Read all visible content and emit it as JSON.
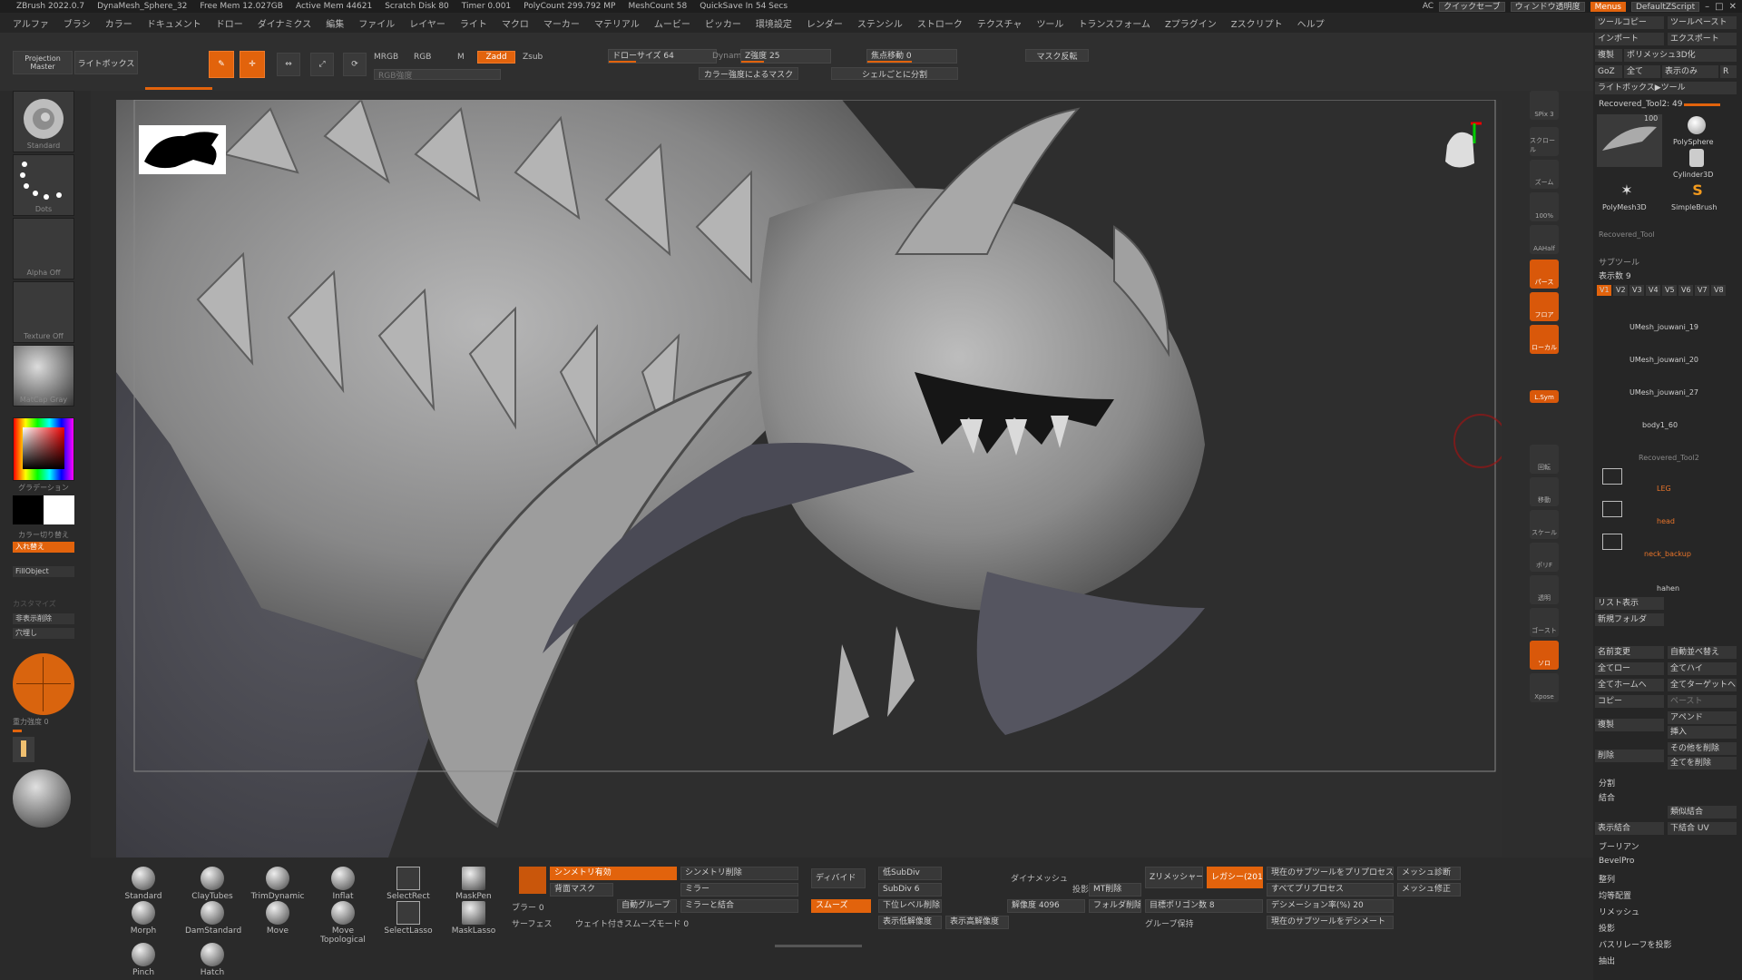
{
  "titlebar": {
    "items": [
      "ZBrush 2022.0.7",
      "DynaMesh_Sphere_32",
      "Free Mem 12.027GB",
      "Active Mem 44621",
      "Scratch Disk 80",
      "Timer 0.001",
      "PolyCount 299.792 MP",
      "MeshCount 58",
      "QuickSave In 54 Secs"
    ],
    "ac": "AC",
    "quicksave": "クイックセーブ",
    "window_transparency": "ウィンドウ透明度",
    "menu": "Menus",
    "default_zscript": "DefaultZScript"
  },
  "menubar": [
    "アルファ",
    "ブラシ",
    "カラー",
    "ドキュメント",
    "ドロー",
    "ダイナミクス",
    "編集",
    "ファイル",
    "レイヤー",
    "ライト",
    "マクロ",
    "マーカー",
    "マテリアル",
    "ムービー",
    "ピッカー",
    "環境設定",
    "レンダー",
    "ステンシル",
    "ストローク",
    "テクスチャ",
    "ツール",
    "トランスフォーム",
    "Zプラグイン",
    "Zスクリプト",
    "ヘルプ"
  ],
  "toolbar": {
    "projection_master": "Projection Master",
    "lightbox": "ライトボックス",
    "edit": "Edit",
    "draw": "Draw",
    "move": "移動",
    "scale": "スケール",
    "rotate": "回転",
    "mrgb": "MRGB",
    "rgb": "RGB",
    "m": "M",
    "zadd": "Zadd",
    "zsub": "Zsub",
    "draw_size": "ドローサイズ 64",
    "z_intensity": "Z強度 25",
    "focal_shift": "焦点移動 0",
    "mask_invert": "マスク反転",
    "color_mask": "カラー強度によるマスク",
    "split_polygroups": "シェルごとに分割",
    "rgb_intensity": "RGB強度",
    "dynamic": "Dynamic",
    "draw_size_pct": 0.25,
    "z_intensity_pct": 0.25,
    "focal_pct": 0.5
  },
  "left": {
    "standard": "Standard",
    "dots": "Dots",
    "alpha_off": "Alpha Off",
    "texture_off": "Texture Off",
    "matcap": "MatCap Gray",
    "gradient": "グラデーション",
    "switch_color": "カラー切り替え",
    "alternate": "入れ替え",
    "fill_object": "FillObject",
    "autoname": "カスタマイズ",
    "backface": "非表示削除",
    "transp": "穴埋し",
    "gravity": "重力強度 0"
  },
  "right_icons": [
    "SPix 3",
    "スクロール",
    "ズーム",
    "100%",
    "AAHalf",
    "パース",
    "フロア",
    "ローカル",
    "L.Sym",
    "回転",
    "移動",
    "スケール",
    "ポリF",
    "透明",
    "ゴースト",
    "ソロ",
    "Xpose"
  ],
  "rpanel": {
    "tool_copy": "ツールコピー",
    "tool_paste": "ツールペースト",
    "import": "インポート",
    "export": "エクスポート",
    "clone": "複製",
    "make_polymesh": "ポリメッシュ3D化",
    "goz": "GoZ",
    "all": "全て",
    "visible": "表示のみ",
    "r": "R",
    "lightbox_tools": "ライトボックス▶ツール",
    "recovered_tool": "Recovered_Tool2: 49",
    "tool_count": "100",
    "polysphere": "PolySphere",
    "cylinder": "Cylinder3D",
    "polymesh": "PolyMesh3D",
    "simplebrush": "SimpleBrush",
    "recovered_small": "Recovered_Tool",
    "subtool": "サブツール",
    "visible_count": "表示数 9",
    "versions": [
      "V1",
      "V2",
      "V3",
      "V4",
      "V5",
      "V6",
      "V7",
      "V8"
    ],
    "subtools": [
      "UMesh_jouwani_19",
      "UMesh_jouwani_20",
      "UMesh_jouwani_27",
      "body1_60",
      "Recovered_Tool2"
    ],
    "folders": [
      "LEG",
      "head",
      "neck_backup"
    ],
    "hahen": "hahen",
    "list_all": "リスト表示",
    "new_folder": "新規フォルダ",
    "rename": "名前変更",
    "auto_reorder": "自動並べ替え",
    "all_low": "全てロー",
    "all_high": "全てハイ",
    "all_to_home": "全てホームへ",
    "all_to_target": "全てターゲットへ",
    "copy": "コピー",
    "paste": "ペースト",
    "duplicate": "複製",
    "append": "アペンド",
    "insert": "挿入",
    "delete": "削除",
    "del_other": "その他を削除",
    "del_all": "全てを削除",
    "split": "分割",
    "merge": "結合",
    "merge_similar": "類似結合",
    "merge_visible": "表示結合",
    "merge_down_uv": "下結合 UV",
    "boolean": "ブーリアン",
    "bevelpro": "BevelPro",
    "align": "整列",
    "distribute": "均等配置",
    "remesh": "リメッシュ",
    "project": "投影",
    "project_bas": "バスリレーフを投影",
    "extract": "抽出"
  },
  "brushes": [
    "Standard",
    "ClayTubes",
    "TrimDynamic",
    "Inflat",
    "SelectRect",
    "MaskPen",
    "Morph",
    "DamStandard",
    "Move",
    "Move Topological",
    "SelectLasso",
    "MaskLasso",
    "Pinch",
    "Hatch"
  ],
  "bottom": {
    "sym_active": "シンメトリ有効",
    "sym_delete": "シンメトリ削除",
    "back_mask": "背面マスク",
    "mirror": "ミラー",
    "auto_group": "自動グループ",
    "mirror_merge": "ミラーと結合",
    "blur": "ブラー 0",
    "smooth": "スムーズ",
    "surface": "サーフェス",
    "weighted_smooth": "ウェイト付きスムーズモード 0",
    "divide": "ディバイド",
    "low_subdiv": "低SubDiv",
    "subdiv": "SubDiv 6",
    "higher_res": "高解像度",
    "lower_res": "下位レベル削除",
    "del_higher": "表示低解像度",
    "del_lower": "表示高解像度",
    "dynamesh": "ダイナメッシュ",
    "project": "投影",
    "resolution": "解像度 4096",
    "group": "MT削除",
    "zremesher": "Zリメッシャー",
    "legacy": "レガシー(2018)",
    "target_poly": "目標ポリゴン数 8",
    "folder_delete": "フォルダ削除",
    "keep_groups": "グループ保持",
    "project_sub": "現在のサブツールをプリプロセス",
    "all_preprocess": "すべてプリプロセス",
    "decimation": "デシメーション率(%) 20",
    "decimate_current": "現在のサブツールをデシメート",
    "mesh_diag": "メッシュ診断",
    "mesh_fix": "メッシュ修正"
  }
}
